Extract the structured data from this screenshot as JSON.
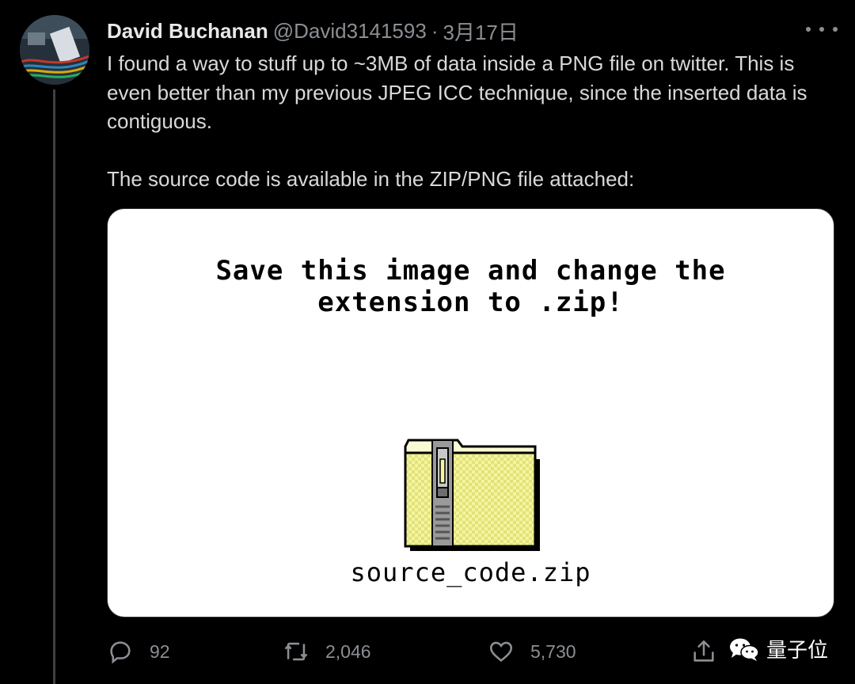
{
  "tweet": {
    "author_name": "David Buchanan",
    "author_handle": "@David3141593",
    "separator": "·",
    "date": "3月17日",
    "text_paragraph_1": "I found a way to stuff up to ~3MB of data inside a PNG file on twitter. This is even better than my previous JPEG ICC technique, since the inserted data is contiguous.",
    "text_paragraph_2": "The source code is available in the ZIP/PNG file attached:"
  },
  "media": {
    "title_line_1": "Save this image and change the",
    "title_line_2": "extension to .zip!",
    "file_name": "source_code.zip",
    "icon": "zip-folder-icon"
  },
  "actions": {
    "reply_count": "92",
    "retweet_count": "2,046",
    "like_count": "5,730"
  },
  "icons": {
    "reply": "reply-icon",
    "retweet": "retweet-icon",
    "like": "heart-icon",
    "share": "share-icon",
    "more": "more-icon"
  },
  "watermark": {
    "text": "量子位"
  },
  "colors": {
    "background": "#000000",
    "text": "#d9d9d9",
    "muted": "#8b8f93",
    "folder_yellow": "#eaea8a"
  }
}
